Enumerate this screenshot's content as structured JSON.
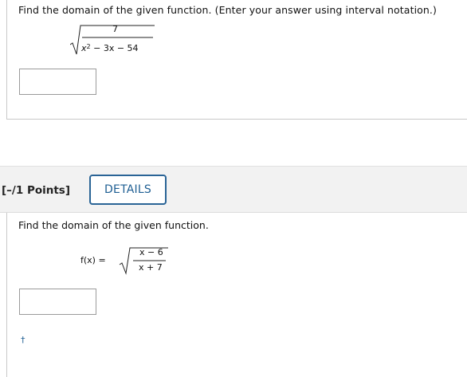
{
  "question1": {
    "prompt": "Find the domain of the given function. (Enter your answer using interval notation.)",
    "numerator": "7",
    "denominator_var": "x",
    "denominator_exp": "2",
    "denominator_rest": " − 3x − 54",
    "answer_value": ""
  },
  "question2": {
    "points_label": "[–/1 Points]",
    "details_label": "DETAILS",
    "prompt": "Find the domain of the given function.",
    "lhs": "f(x)  =",
    "numerator": "x − 6",
    "denominator": "x + 7",
    "answer_value": "",
    "footnote_symbol": "†"
  }
}
